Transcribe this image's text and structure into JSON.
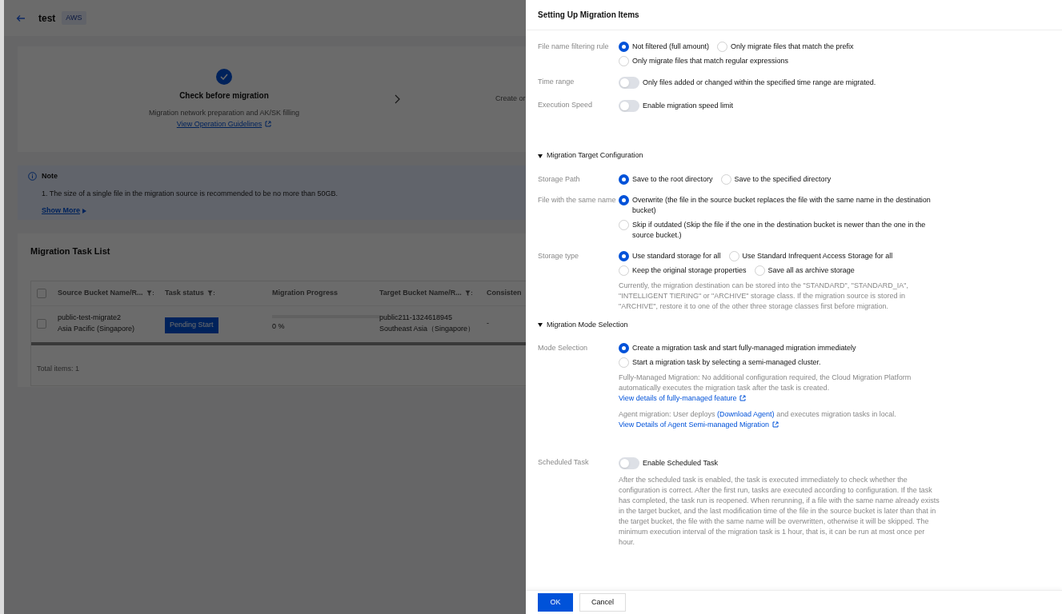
{
  "page": {
    "title": "test",
    "tag": "AWS",
    "steps": [
      {
        "title": "Check before migration",
        "done": true,
        "description": "Migration network preparation and AK/SK filling",
        "link": "View Operation Guidelines"
      },
      {
        "description": "Create or"
      }
    ],
    "note": {
      "title": "Note",
      "lines": [
        "1. The size of a single file in the migration source is recommended to be no more than 50GB."
      ],
      "more": "Show More"
    },
    "task_list": {
      "title": "Migration Task List",
      "all_checked": false,
      "columns": [
        {
          "label": "Source Bucket Name/R...",
          "filter": true
        },
        {
          "label": "Task status",
          "filter": true
        },
        {
          "label": "Migration Progress",
          "filter": false
        },
        {
          "label": "Target Bucket Name/R...",
          "filter": true
        },
        {
          "label": "Consisten",
          "filter": false
        }
      ],
      "rows": [
        {
          "checked": false,
          "source": "public-test-migrate2",
          "source_region": "Asia Pacific (Singapore)",
          "status": "Pending Start",
          "level": 0,
          "progress": "0 %",
          "target": "public211-1324618945",
          "target_region": "Southeast Asia（Singapore）",
          "consistency": "-"
        }
      ],
      "total": "Total items: 1"
    }
  },
  "drawer": {
    "title": "Setting Up Migration Items",
    "fields": [
      {
        "kind": "radio",
        "label": "File name filtering rule",
        "options": [
          {
            "label": "Not filtered (full amount)",
            "selected": true
          },
          {
            "label": "Only migrate files that match the prefix",
            "selected": false
          },
          {
            "label": "Only migrate files that match regular expressions",
            "selected": false
          }
        ]
      },
      {
        "kind": "toggle",
        "label": "Time range",
        "on": false,
        "text": "Only files added or changed within the specified time range are migrated."
      },
      {
        "kind": "toggle",
        "label": "Execution Speed",
        "on": false,
        "text": "Enable migration speed limit"
      },
      {
        "kind": "heading",
        "label": "Migration Target Configuration",
        "expanded": true
      },
      {
        "kind": "radio",
        "label": "Storage Path",
        "options": [
          {
            "label": "Save to the root directory",
            "selected": true
          },
          {
            "label": "Save to the specified directory",
            "selected": false
          }
        ]
      },
      {
        "kind": "radio",
        "label": "File with the same name",
        "options": [
          {
            "label": "Overwrite (the file in the source bucket replaces the file with the same name in the destination bucket)",
            "selected": true
          },
          {
            "label": "Skip if outdated (Skip the file if the one in the destination bucket is newer than the one in the source bucket.)",
            "selected": false
          }
        ]
      },
      {
        "kind": "radio",
        "label": "Storage type",
        "options": [
          {
            "label": "Use standard storage for all",
            "selected": true
          },
          {
            "label": "Use Standard Infrequent Access Storage for all",
            "selected": false
          },
          {
            "label": "Keep the original storage properties",
            "selected": false
          },
          {
            "label": "Save all as archive storage",
            "selected": false
          }
        ],
        "notes": [
          [
            {
              "text": "Currently, the migration destination can be stored into the \"STANDARD\", \"STANDARD_IA\", \"INTELLIGENT TIERING\" or \"ARCHIVE\" storage class. If the migration source is stored in \"ARCHIVE\", restore it to one of the other three storage classes first before migration.",
              "link": false
            }
          ]
        ]
      },
      {
        "kind": "heading",
        "label": "Migration Mode Selection",
        "expanded": true
      },
      {
        "kind": "radio",
        "label": "Mode Selection",
        "options": [
          {
            "label": "Create a migration task and start fully-managed migration immediately",
            "selected": true
          },
          {
            "label": "Start a migration task by selecting a semi-managed cluster.",
            "selected": false
          }
        ],
        "notes": [
          [
            {
              "text": "Fully-Managed Migration: No additional configuration required, the Cloud Migration Platform automatically executes the migration task after the task is created.",
              "link": false
            },
            {
              "text": "View details of fully-managed feature",
              "link": true,
              "external": true
            }
          ],
          [
            {
              "text": "Agent migration: User deploys",
              "link": false
            },
            {
              "text": "(Download Agent)",
              "link": true,
              "external": false
            },
            {
              "text": "and executes migration tasks in local.",
              "link": false
            },
            {
              "text": "View Details of Agent Semi-managed Migration",
              "link": true,
              "external": true
            }
          ]
        ]
      },
      {
        "kind": "toggle",
        "label": "Scheduled Task",
        "on": false,
        "text": "Enable Scheduled Task",
        "notes": [
          [
            {
              "text": "After the scheduled task is enabled, the task is executed immediately to check whether the configuration is correct. After the first run, tasks are executed according to configuration. If the task has completed, the task run is reopened. When rerunning, if a file with the same name already exists in the target bucket, and the last modification time of the file in the source bucket is later than that in the target bucket, the file with the same name will be overwritten, otherwise it will be skipped. The minimum execution interval of the migration task is 1 hour, that is, it can be run at most once per hour.",
              "link": false
            }
          ]
        ]
      }
    ],
    "buttons": [
      {
        "label": "OK",
        "primary": true
      },
      {
        "label": "Cancel",
        "primary": false
      }
    ]
  }
}
